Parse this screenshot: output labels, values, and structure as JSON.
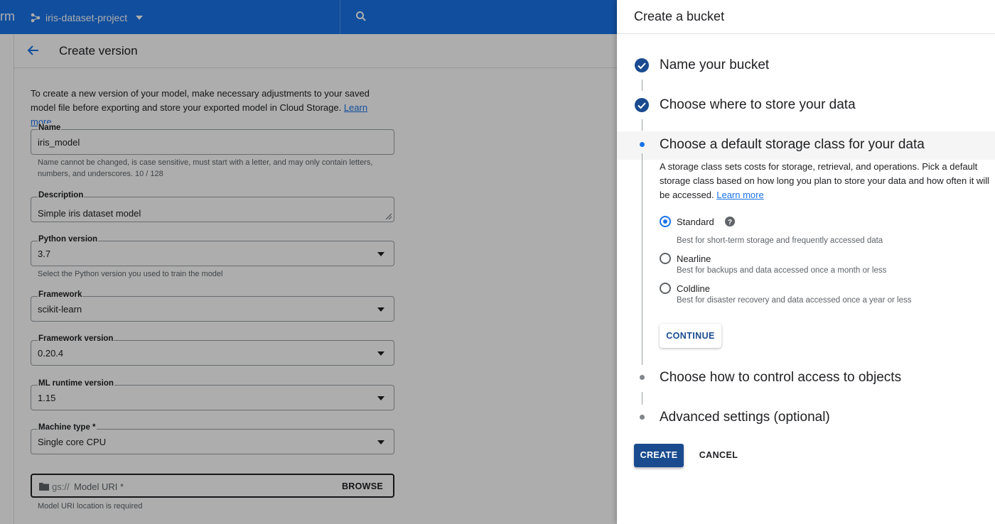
{
  "console": {
    "brand": "rm",
    "project": "iris-dataset-project",
    "page_title": "Create version",
    "intro_text": "To create a new version of your model, make necessary adjustments to your saved model file before exporting and store your exported model in Cloud Storage.",
    "intro_link": "Learn more",
    "fields": {
      "name": {
        "label": "Name",
        "value": "iris_model",
        "hint": "Name cannot be changed, is case sensitive, must start with a letter, and may only contain letters, numbers, and underscores. 10 / 128"
      },
      "description": {
        "label": "Description",
        "value": "Simple iris dataset model"
      },
      "python": {
        "label": "Python version",
        "value": "3.7",
        "hint": "Select the Python version you used to train the model"
      },
      "framework": {
        "label": "Framework",
        "value": "scikit-learn"
      },
      "framework_version": {
        "label": "Framework version",
        "value": "0.20.4"
      },
      "runtime": {
        "label": "ML runtime version",
        "value": "1.15"
      },
      "machine": {
        "label": "Machine type *",
        "value": "Single core CPU"
      },
      "uri": {
        "prefix": "gs://",
        "placeholder": "Model URI *",
        "browse": "BROWSE",
        "hint": "Model URI location is required"
      }
    }
  },
  "panel": {
    "title": "Create a bucket",
    "steps": [
      {
        "title": "Name your bucket",
        "state": "done"
      },
      {
        "title": "Choose where to store your data",
        "state": "done"
      },
      {
        "title": "Choose a default storage class for your data",
        "state": "active"
      },
      {
        "title": "Choose how to control access to objects",
        "state": "pending"
      },
      {
        "title": "Advanced settings (optional)",
        "state": "pending"
      }
    ],
    "storage_desc": "A storage class sets costs for storage, retrieval, and operations. Pick a default storage class based on how long you plan to store your data and how often it will be accessed.",
    "storage_link": "Learn more",
    "options": [
      {
        "label": "Standard",
        "desc": "Best for short-term storage and frequently accessed data",
        "selected": true
      },
      {
        "label": "Nearline",
        "desc": "Best for backups and data accessed once a month or less",
        "selected": false
      },
      {
        "label": "Coldline",
        "desc": "Best for disaster recovery and data accessed once a year or less",
        "selected": false
      }
    ],
    "continue_label": "CONTINUE",
    "create_label": "CREATE",
    "cancel_label": "CANCEL"
  },
  "colors": {
    "topbar": "#1a73e8",
    "primary": "#1a4b8f",
    "check": "#1a4b8f"
  },
  "icons": [
    "project-icon",
    "search-icon",
    "back-arrow-icon",
    "folder-icon",
    "check-circle-icon",
    "help-icon",
    "chevron-down-icon"
  ]
}
